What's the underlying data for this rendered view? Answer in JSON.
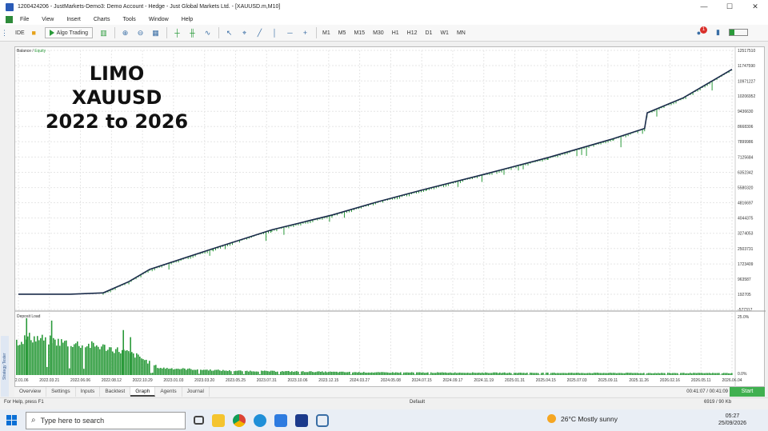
{
  "window": {
    "title": "1200424206 - JustMarkets-Demo3: Demo Account - Hedge - Just Global Markets Ltd. - [XAUUSD.m,M10]",
    "controls": [
      "—",
      "☐",
      "✕"
    ]
  },
  "menu": [
    "File",
    "View",
    "Insert",
    "Charts",
    "Tools",
    "Window",
    "Help"
  ],
  "toolbar": {
    "ide": "IDE",
    "algo_trading": "Algo Trading",
    "timeframes": [
      "M1",
      "M5",
      "M15",
      "M30",
      "H1",
      "H12",
      "D1",
      "W1",
      "MN"
    ],
    "notification_count": "1"
  },
  "overlay": {
    "line1": "LIMO",
    "line2": "XAUUSD",
    "line3": "2022 to 2026"
  },
  "colors": {
    "balance": "#1a2b4a",
    "equity": "#2a9a3a",
    "deposit": "#2a9a3a",
    "start": "#40b050"
  },
  "chart_data": [
    {
      "type": "line",
      "title": "",
      "legend": [
        "Balance",
        "Equity"
      ],
      "xlabel": "",
      "ylabel": "",
      "y_ticks": [
        "12517510",
        "11747590",
        "10971227",
        "10206952",
        "9436630",
        "8668306",
        "7899986",
        "7125684",
        "6352342",
        "5580320",
        "4816697",
        "4044375",
        "3274053",
        "2503731",
        "1723409",
        "963587",
        "192705",
        "-577317"
      ],
      "ylim": [
        -577317,
        12517510
      ],
      "series": [
        {
          "name": "Balance",
          "x": [
            "2022.01.06",
            "2022.05.01",
            "2022.07.15",
            "2022.09.12",
            "2022.10.29",
            "2023.03.20",
            "2023.07.31",
            "2023.12.15",
            "2024.03.27",
            "2024.07.15",
            "2024.11.19",
            "2025.04.15",
            "2025.09.11",
            "2025.11.20",
            "2025.11.26",
            "2026.02.16",
            "2026.06.04"
          ],
          "values": [
            192705,
            192705,
            260000,
            830000,
            1450000,
            2500000,
            3450000,
            4200000,
            4870000,
            5520000,
            6230000,
            7100000,
            8060000,
            8570000,
            9360000,
            10120000,
            11560000
          ]
        }
      ],
      "x_ticks": [
        "2022.01.06",
        "2022.03.21",
        "2022.06.06",
        "2022.08.12",
        "2022.10.29",
        "2023.01.03",
        "2023.03.20",
        "2023.05.25",
        "2023.07.31",
        "2023.10.06",
        "2023.12.15",
        "2024.03.27",
        "2024.05.08",
        "2024.07.15",
        "2024.09.17",
        "2024.11.19",
        "2025.01.31",
        "2025.04.15",
        "2025.07.03",
        "2025.09.11",
        "2025.11.26",
        "2026.02.16",
        "2026.05.11",
        "2026.06.04"
      ]
    },
    {
      "type": "bar",
      "title": "Deposit Load",
      "y_ticks": [
        "25.0%",
        "0.0%"
      ],
      "ylim": [
        0,
        25
      ],
      "profile_x": [
        0,
        0.02,
        0.06,
        0.12,
        0.15,
        0.17,
        0.2,
        0.3,
        0.5,
        0.75,
        1
      ],
      "profile_values": [
        14,
        16,
        14,
        12,
        10,
        8,
        3,
        1.8,
        1.1,
        0.9,
        0.8
      ],
      "spikes": [
        {
          "x": 0.015,
          "value": 24
        },
        {
          "x": 0.05,
          "value": 23
        },
        {
          "x": 0.15,
          "value": 19
        },
        {
          "x": 0.16,
          "value": 16
        }
      ]
    }
  ],
  "tabs": [
    "Overview",
    "Settings",
    "Inputs",
    "Backtest",
    "Graph",
    "Agents",
    "Journal"
  ],
  "active_tab": "Graph",
  "side_label": "Strategy Tester",
  "times": "00:41:07 / 00:41:09",
  "start_button": "Start",
  "status": {
    "help": "For Help, press F1",
    "profile": "Default",
    "net": "6919 / 90 Kb"
  },
  "taskbar": {
    "search_placeholder": "Type here to search",
    "weather": "26°C  Mostly sunny",
    "time": "05:27",
    "date": "25/09/2026"
  }
}
